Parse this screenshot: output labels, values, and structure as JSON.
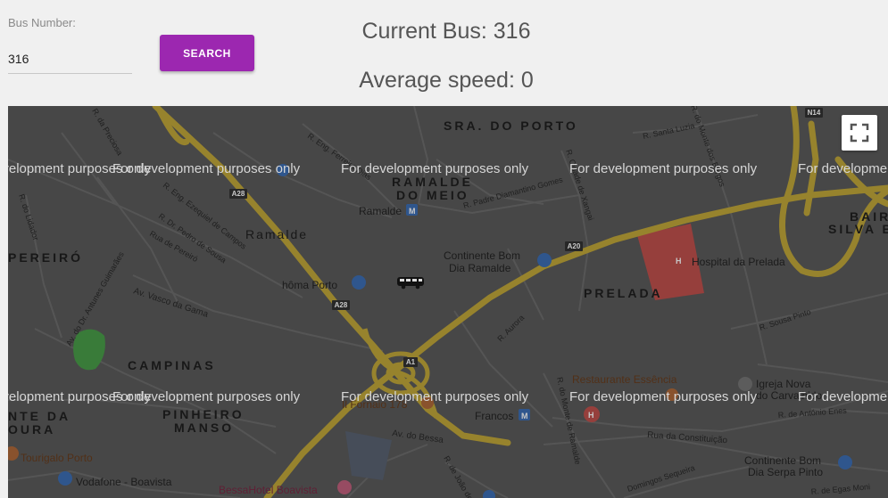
{
  "form": {
    "bus_number_label": "Bus Number:",
    "bus_number_value": "316",
    "search_label": "SEARCH"
  },
  "status": {
    "current_bus": "Current Bus: 316",
    "average_speed": "Average speed: 0"
  },
  "map": {
    "watermark": "For development purposes only",
    "neighborhoods": {
      "sra_do_porto": "SRA. DO PORTO",
      "ramalde_do_meio_1": "RAMALDE",
      "ramalde_do_meio_2": "DO MEIO",
      "ramalde": "Ramalde",
      "pereiro": "PEREIRÓ",
      "prelada": "PRELADA",
      "campinas": "CAMPINAS",
      "pinheiro_manso_1": "PINHEIRO",
      "pinheiro_manso_2": "MANSO",
      "bairro_silva_1": "BAIR",
      "bairro_silva_2": "SILVA BR",
      "monte_da_moura_1": "NTE DA",
      "monte_da_moura_2": "OURA"
    },
    "places": {
      "ramalde_metro": "Ramalde",
      "continente_1": "Continente Bom",
      "continente_2": "Dia Ramalde",
      "homa": "hôma Porto",
      "hospital": "Hospital da Prelada",
      "restaurante": "Restaurante Essência",
      "igreja_1": "Igreja Nova",
      "igreja_2": "do Carvalhido",
      "il_fornaio": "Il Fornaio 178",
      "francos": "Francos",
      "tourigalo": "Tourigalo Porto",
      "vodafone": "Vodafone - Boavista",
      "bessa_hotel": "BessaHotel Boavista",
      "continente_serpa_1": "Continente Bom",
      "continente_serpa_2": "Dia Serpa Pinto"
    },
    "roads": {
      "a28_1": "A28",
      "a28_2": "A28",
      "a20": "A20",
      "a1": "A1",
      "n14": "N14",
      "r_precioca": "R. da Preciosa",
      "r_eng_ferreira_dias": "R. Eng. Ferreira Dias",
      "r_eng_ezequiel": "R. Eng. Ezequiel de Campos",
      "r_dr_pedro": "R. Dr. Pedro de Sousa",
      "rua_pereiro": "Rua de Pereiró",
      "av_antunes": "Av. do Dr. Antunes Guimarães",
      "r_lidador": "R. do Lidador",
      "av_vasco_gama": "Av. Vasco da Gama",
      "r_padre_diamantino": "R. Padre Diamantino Gomes",
      "cidade_xangai": "R. Cidade de Xangai",
      "r_santa_luzia": "R. Santa Luzia",
      "r_monte_burgos": "R. do Monte dos Burgos",
      "r_sousa_pinto": "R. Sousa Pinto",
      "r_aurora": "R. Aurora",
      "r_monte_ramalde": "R. do Monte de Ramalde",
      "r_antonio_enes": "R. de António Enes",
      "rua_constituicao": "Rua da Constituição",
      "av_bessa": "Av. do Bessa",
      "domingos_sequeira": "Domingos Sequeira",
      "r_egas_moniz": "R. de Egas Moni",
      "r_joao": "R. de João de"
    }
  }
}
